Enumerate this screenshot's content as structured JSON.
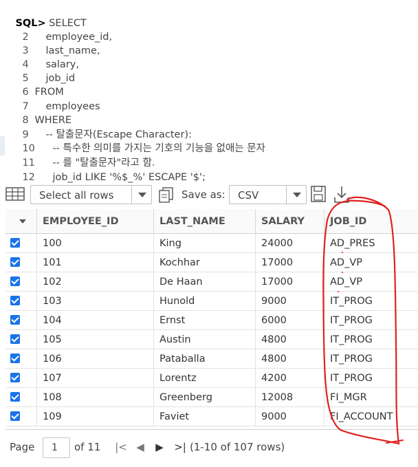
{
  "editor": {
    "prompt": "SQL>",
    "lines": [
      {
        "num": "",
        "text": " SELECT"
      },
      {
        "num": "2",
        "text": "employee_id,"
      },
      {
        "num": "3",
        "text": "last_name,"
      },
      {
        "num": "4",
        "text": "salary,"
      },
      {
        "num": "5",
        "text": "job_id"
      },
      {
        "num": "6",
        "text": "FROM"
      },
      {
        "num": "7",
        "text": "employees"
      },
      {
        "num": "8",
        "text": "WHERE"
      },
      {
        "num": "9",
        "text": "-- 탈출문자(Escape Character):"
      },
      {
        "num": "10",
        "text": "-- 특수한 의미를 가지는 기호의 기능을 없애는 문자"
      },
      {
        "num": "11",
        "text": "-- 를 \"탈출문자\"라고 함."
      },
      {
        "num": "12",
        "text": "job_id LIKE '%$_%' ESCAPE '$';"
      }
    ]
  },
  "toolbar": {
    "row_select": "Select all rows",
    "save_as_label": "Save as:",
    "format": "CSV"
  },
  "grid": {
    "columns": [
      "EMPLOYEE_ID",
      "LAST_NAME",
      "SALARY",
      "JOB_ID"
    ],
    "rows": [
      {
        "employee_id": "100",
        "last_name": "King",
        "salary": "24000",
        "job_id": "AD_PRES"
      },
      {
        "employee_id": "101",
        "last_name": "Kochhar",
        "salary": "17000",
        "job_id": "AD_VP"
      },
      {
        "employee_id": "102",
        "last_name": "De Haan",
        "salary": "17000",
        "job_id": "AD_VP"
      },
      {
        "employee_id": "103",
        "last_name": "Hunold",
        "salary": "9000",
        "job_id": "IT_PROG"
      },
      {
        "employee_id": "104",
        "last_name": "Ernst",
        "salary": "6000",
        "job_id": "IT_PROG"
      },
      {
        "employee_id": "105",
        "last_name": "Austin",
        "salary": "4800",
        "job_id": "IT_PROG"
      },
      {
        "employee_id": "106",
        "last_name": "Pataballa",
        "salary": "4800",
        "job_id": "IT_PROG"
      },
      {
        "employee_id": "107",
        "last_name": "Lorentz",
        "salary": "4200",
        "job_id": "IT_PROG"
      },
      {
        "employee_id": "108",
        "last_name": "Greenberg",
        "salary": "12008",
        "job_id": "FI_MGR"
      },
      {
        "employee_id": "109",
        "last_name": "Faviet",
        "salary": "9000",
        "job_id": "FI_ACCOUNT"
      }
    ]
  },
  "pager": {
    "page_label": "Page",
    "current_page": "1",
    "of_label": "of 11",
    "range_text": "(1-10 of 107 rows)"
  },
  "colors": {
    "checkbox": "#1a73e8",
    "annotation": "#e02020"
  }
}
